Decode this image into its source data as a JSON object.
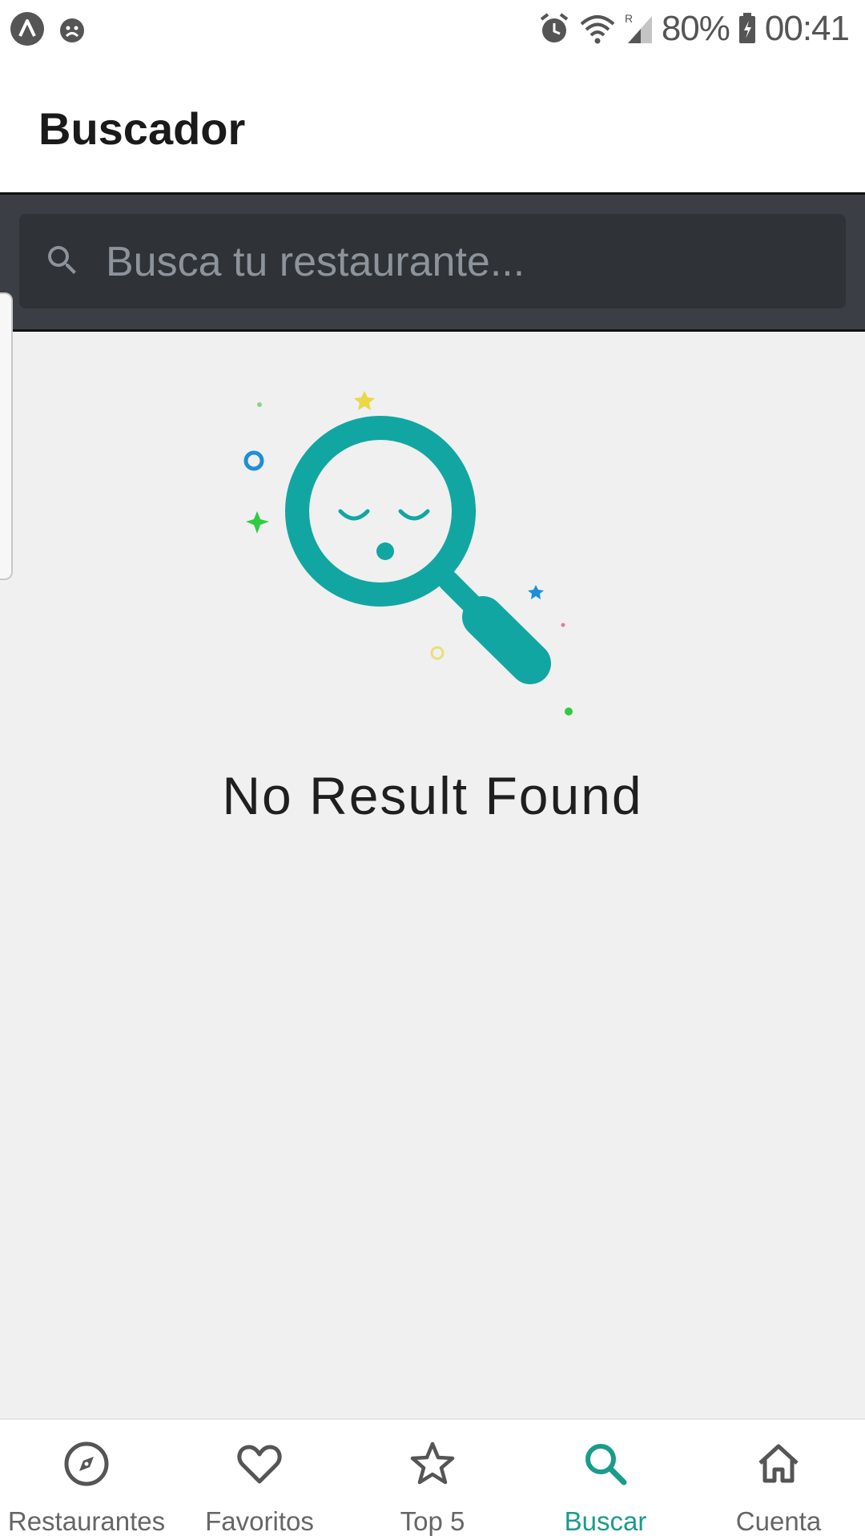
{
  "status_bar": {
    "battery": "80%",
    "time": "00:41",
    "icons": [
      "app-a-icon",
      "face-notification-icon",
      "alarm-icon",
      "wifi-icon",
      "signal-icon",
      "battery-icon"
    ]
  },
  "app_bar": {
    "title": "Buscador"
  },
  "search": {
    "placeholder": "Busca tu restaurante...",
    "value": ""
  },
  "empty_state": {
    "message": "No Result Found",
    "illustration": "sleeping-magnifier-icon"
  },
  "colors": {
    "accent": "#1a9c8c",
    "illustration_teal": "#12a6a3",
    "search_bar_bg": "#3b3f45"
  },
  "bottom_nav": {
    "items": [
      {
        "label": "Restaurantes",
        "icon": "compass-icon",
        "active": false
      },
      {
        "label": "Favoritos",
        "icon": "heart-icon",
        "active": false
      },
      {
        "label": "Top 5",
        "icon": "star-icon",
        "active": false
      },
      {
        "label": "Buscar",
        "icon": "search-icon",
        "active": true
      },
      {
        "label": "Cuenta",
        "icon": "home-icon",
        "active": false
      }
    ]
  }
}
